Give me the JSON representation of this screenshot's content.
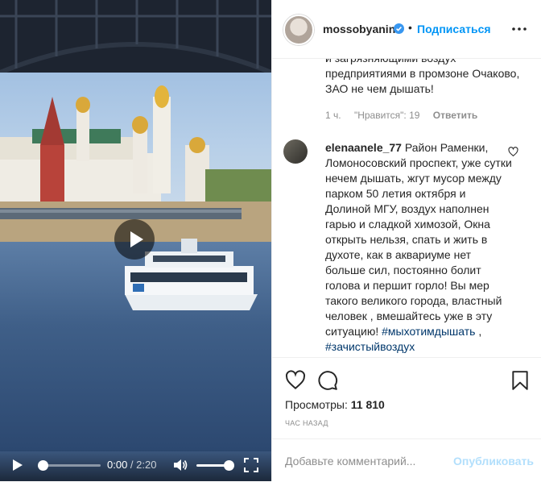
{
  "video": {
    "current_time": "0:00",
    "separator": " / ",
    "duration": "2:20",
    "progress": 0.0,
    "volume": 1.0
  },
  "header": {
    "username": "mossobyanin",
    "dot": "•",
    "follow_label": "Подписаться"
  },
  "comments": {
    "first": {
      "text": "и загрязняющими воздух предприятиями в промзоне Очаково, ЗАО не чем дышать!",
      "time": "1 ч.",
      "likes": "\"Нравится\": 19",
      "reply": "Ответить"
    },
    "second": {
      "username": "elenaanele_77",
      "text": " Район Раменки, Ломоносовский проспект, уже сутки нечем дышать, жгут мусор между парком 50 летия октября и Долиной МГУ, воздух наполнен гарью и сладкой химозой, Окна открыть нельзя, спать и жить в духоте, как в аквариуме нет больше сил, постоянно болит голова и першит горло! Вы мер такого великого города, властный человек , вмешайтесь уже в эту ситуацию! ",
      "tag1": "#мыхотимдышать",
      "sep": " , ",
      "tag2": "#зачистыйвоздух"
    }
  },
  "stats": {
    "views_label": "Просмотры: ",
    "views_value": "11 810",
    "ago": "ЧАС НАЗАД"
  },
  "add_comment": {
    "placeholder": "Добавьте комментарий...",
    "publish_label": "Опубликовать"
  },
  "colors": {
    "accent": "#0095f6",
    "publish_disabled": "#b2dffc",
    "hashtag": "#00376b",
    "muted": "#8e8e8e"
  },
  "icons": [
    "play-icon",
    "volume-icon",
    "fullscreen-icon",
    "verified-badge-icon",
    "more-options-icon",
    "heart-icon",
    "comment-icon",
    "bookmark-icon"
  ]
}
